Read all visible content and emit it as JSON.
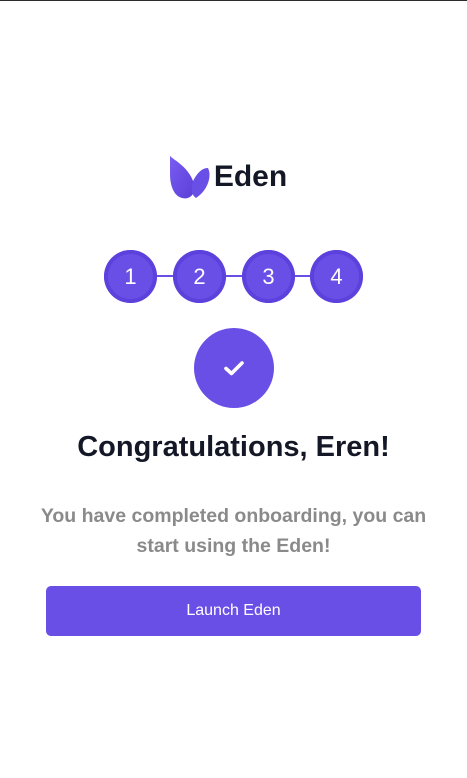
{
  "brand": {
    "name": "Eden",
    "logo_icon": "leaf-logo-icon",
    "accent_color": "#6a4fe6"
  },
  "stepper": {
    "steps": [
      "1",
      "2",
      "3",
      "4"
    ]
  },
  "status_icon": "check-icon",
  "title": "Congratulations, Eren!",
  "subtitle": "You have completed onboarding, you can start using the Eden!",
  "launch_button": {
    "label": "Launch Eden"
  }
}
